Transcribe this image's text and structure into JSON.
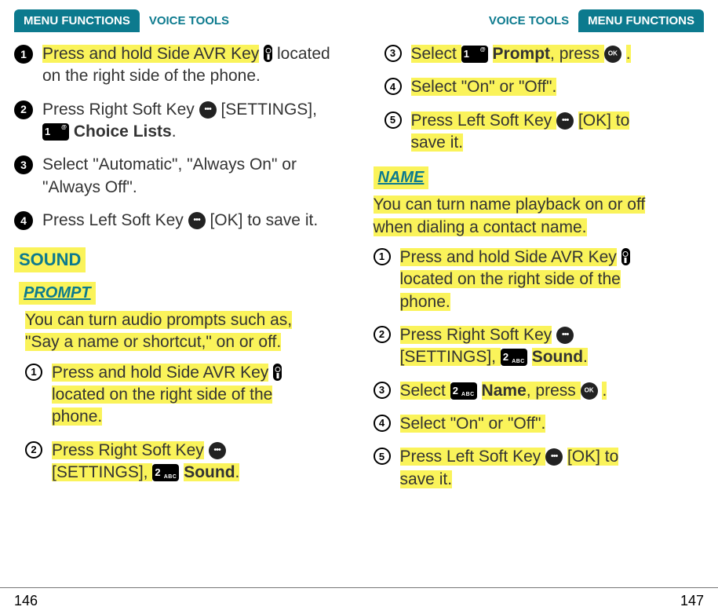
{
  "left": {
    "tab": "MENU FUNCTIONS",
    "section": "VOICE TOOLS",
    "page_no": "146",
    "mainSteps": {
      "s1_a": "Press and hold Side AVR Key",
      "s1_b": "located on the right side of the phone.",
      "s2_a": "Press Right Soft Key ",
      "s2_b": " [SETTINGS], ",
      "s2_c": "Choice Lists",
      "s3": "Select \"Automatic\", \"Always On\" or \"Always Off\".",
      "s4_a": "Press Left Soft Key ",
      "s4_b": " [OK] to save it."
    },
    "sound_header": "SOUND",
    "prompt_header": "PROMPT",
    "prompt_intro_a": "You can turn audio prompts such as,",
    "prompt_intro_b": "\"Say a name or shortcut,\" on or off.",
    "promptSteps": {
      "s1_a": "Press and hold Side AVR Key",
      "s1_b": "located on the right side of the",
      "s1_c": "phone.",
      "s2_a": "Press Right Soft Key",
      "s2_b": "[SETTINGS], ",
      "s2_c": "Sound"
    },
    "keys": {
      "one_sup": "@",
      "two_abc": "ABC"
    }
  },
  "right": {
    "tab": "MENU FUNCTIONS",
    "section": "VOICE TOOLS",
    "page_no": "147",
    "promptCont": {
      "s3_a": "Select ",
      "s3_b": "Prompt",
      "s3_c": ", press ",
      "s4": "Select \"On\" or \"Off\".",
      "s5_a": "Press Left Soft Key ",
      "s5_b": " [OK] to",
      "s5_c": "save it."
    },
    "name_header": "NAME",
    "name_intro_a": "You can turn name playback on or off",
    "name_intro_b": "when dialing a contact name.",
    "nameSteps": {
      "s1_a": "Press and hold Side AVR Key",
      "s1_b": "located on the right side of the",
      "s1_c": "phone.",
      "s2_a": "Press Right Soft Key",
      "s2_b": "[SETTINGS], ",
      "s2_c": "Sound",
      "s3_a": "Select ",
      "s3_b": "Name",
      "s3_c": ", press ",
      "s4": "Select \"On\" or \"Off\".",
      "s5_a": "Press Left Soft Key ",
      "s5_b": " [OK] to",
      "s5_c": "save it."
    }
  }
}
